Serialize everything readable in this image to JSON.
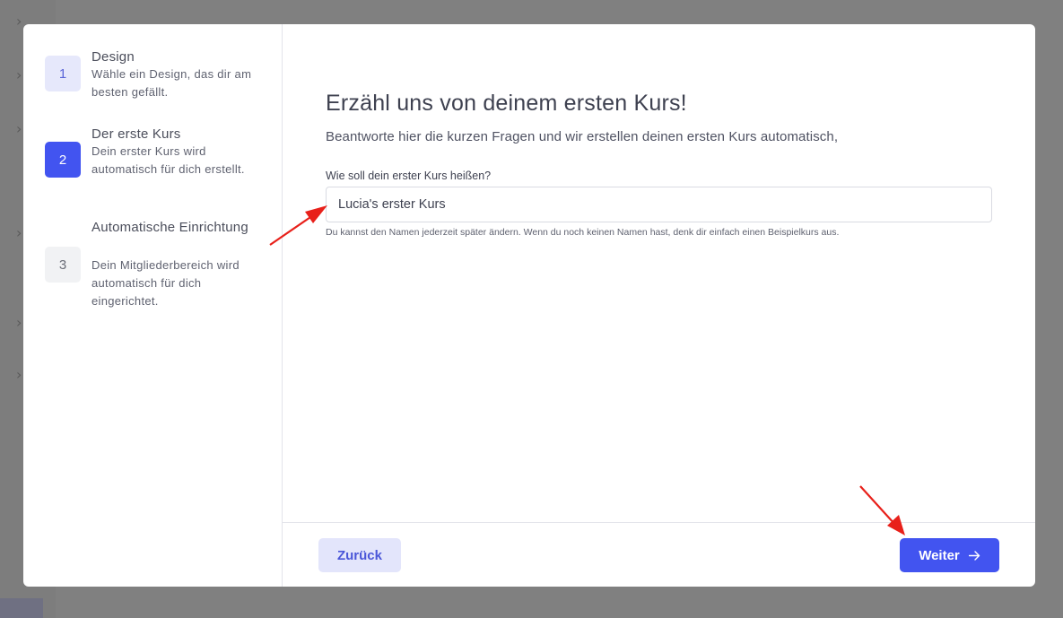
{
  "background": {
    "chevron_glyph": "›"
  },
  "steps": [
    {
      "number": "1",
      "title": "Design",
      "description": "Wähle ein Design, das dir am besten gefällt.",
      "state": "done"
    },
    {
      "number": "2",
      "title": "Der erste Kurs",
      "description": "Dein erster Kurs wird automatisch für dich erstellt.",
      "state": "active"
    },
    {
      "number": "3",
      "title": "Automatische Einrichtung",
      "description": "Dein Mitgliederbereich wird automatisch für dich eingerichtet.",
      "state": "todo"
    }
  ],
  "main": {
    "heading": "Erzähl uns von deinem ersten Kurs!",
    "subheading": "Beantworte hier die kurzen Fragen und wir erstellen deinen ersten Kurs automatisch,",
    "course_name": {
      "label": "Wie soll dein erster Kurs heißen?",
      "value": "Lucia's erster Kurs",
      "helper": "Du kannst den Namen jederzeit später ändern. Wenn du noch keinen Namen hast, denk dir einfach einen Beispielkurs aus."
    }
  },
  "footer": {
    "back_label": "Zurück",
    "next_label": "Weiter",
    "next_icon": "arrow-right-icon"
  },
  "colors": {
    "accent": "#4254f0",
    "accent_light": "#e3e5fb",
    "annotation_arrow": "#e8201a",
    "overlay": "#808080"
  }
}
